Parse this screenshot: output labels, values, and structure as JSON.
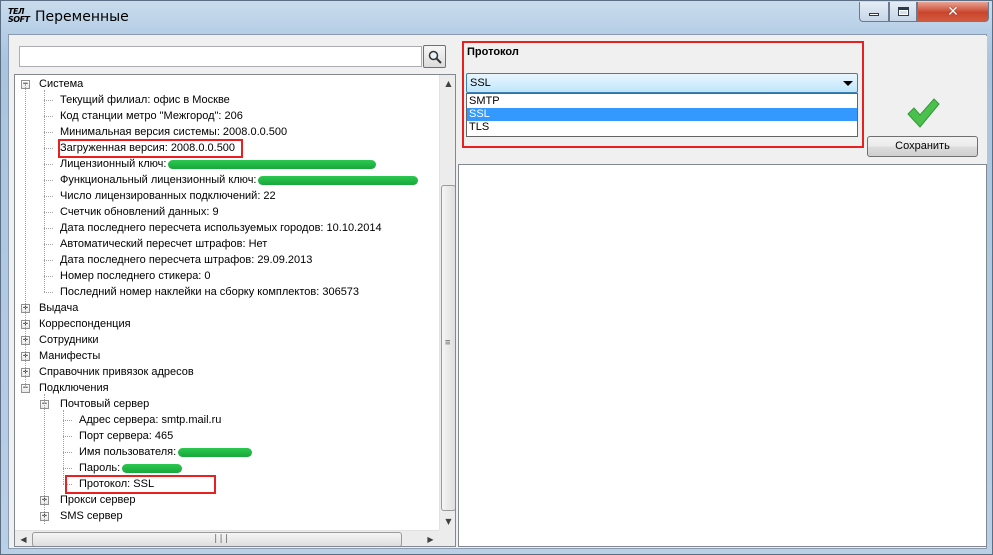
{
  "window": {
    "title": "Переменные",
    "icon_text_1": "ТЕЛ",
    "icon_text_2": "SOFT"
  },
  "search": {
    "value": "",
    "placeholder": ""
  },
  "tree": {
    "nodes": [
      {
        "label": "Система",
        "level": 0,
        "expanded": true
      },
      {
        "label": "Текущий филиал: офис в Москве",
        "level": 1
      },
      {
        "label": "Код станции метро \"Межгород\": 206",
        "level": 1
      },
      {
        "label": "Минимальная версия системы: 2008.0.0.500",
        "level": 1
      },
      {
        "label": "Загруженная версия: 2008.0.0.500",
        "level": 1,
        "highlighted": true
      },
      {
        "label": "Лицензионный ключ:",
        "level": 1,
        "redacted": true
      },
      {
        "label": "Функциональный лицензионный ключ:",
        "level": 1,
        "redacted": true
      },
      {
        "label": "Число лицензированных подключений: 22",
        "level": 1
      },
      {
        "label": "Счетчик обновлений данных: 9",
        "level": 1
      },
      {
        "label": "Дата последнего пересчета используемых городов: 10.10.2014",
        "level": 1
      },
      {
        "label": "Автоматический пересчет штрафов: Нет",
        "level": 1
      },
      {
        "label": "Дата последнего пересчета штрафов: 29.09.2013",
        "level": 1
      },
      {
        "label": "Номер последнего стикера: 0",
        "level": 1
      },
      {
        "label": "Последний номер наклейки на сборку комплектов: 306573",
        "level": 1
      },
      {
        "label": "Выдача",
        "level": 0,
        "expanded": false
      },
      {
        "label": "Корреспонденция",
        "level": 0,
        "expanded": false
      },
      {
        "label": "Сотрудники",
        "level": 0,
        "expanded": false
      },
      {
        "label": "Манифесты",
        "level": 0,
        "expanded": false
      },
      {
        "label": "Справочник привязок адресов",
        "level": 0,
        "expanded": false
      },
      {
        "label": "Подключения",
        "level": 0,
        "expanded": true
      },
      {
        "label": "Почтовый сервер",
        "level": 1,
        "expanded": true
      },
      {
        "label": "Адрес сервера: smtp.mail.ru",
        "level": 2
      },
      {
        "label": "Порт сервера: 465",
        "level": 2
      },
      {
        "label": "Имя пользователя:",
        "level": 2,
        "redacted": true
      },
      {
        "label": "Пароль:",
        "level": 2,
        "redacted": true
      },
      {
        "label": "Протокол: SSL",
        "level": 2,
        "highlighted": true
      },
      {
        "label": "Прокси сервер",
        "level": 1,
        "expanded": false
      },
      {
        "label": "SMS сервер",
        "level": 1,
        "expanded": false
      }
    ]
  },
  "editor": {
    "field_label": "Протокол",
    "selected_value": "SSL",
    "options": [
      "SMTP",
      "SSL",
      "TLS"
    ],
    "selected_index": 1,
    "save_label": "Сохранить"
  },
  "colors": {
    "highlight_border": "#e8201f",
    "redaction": "#1fb544",
    "check_mark": "#3fbf4a",
    "dropdown_selection": "#3399ff"
  }
}
